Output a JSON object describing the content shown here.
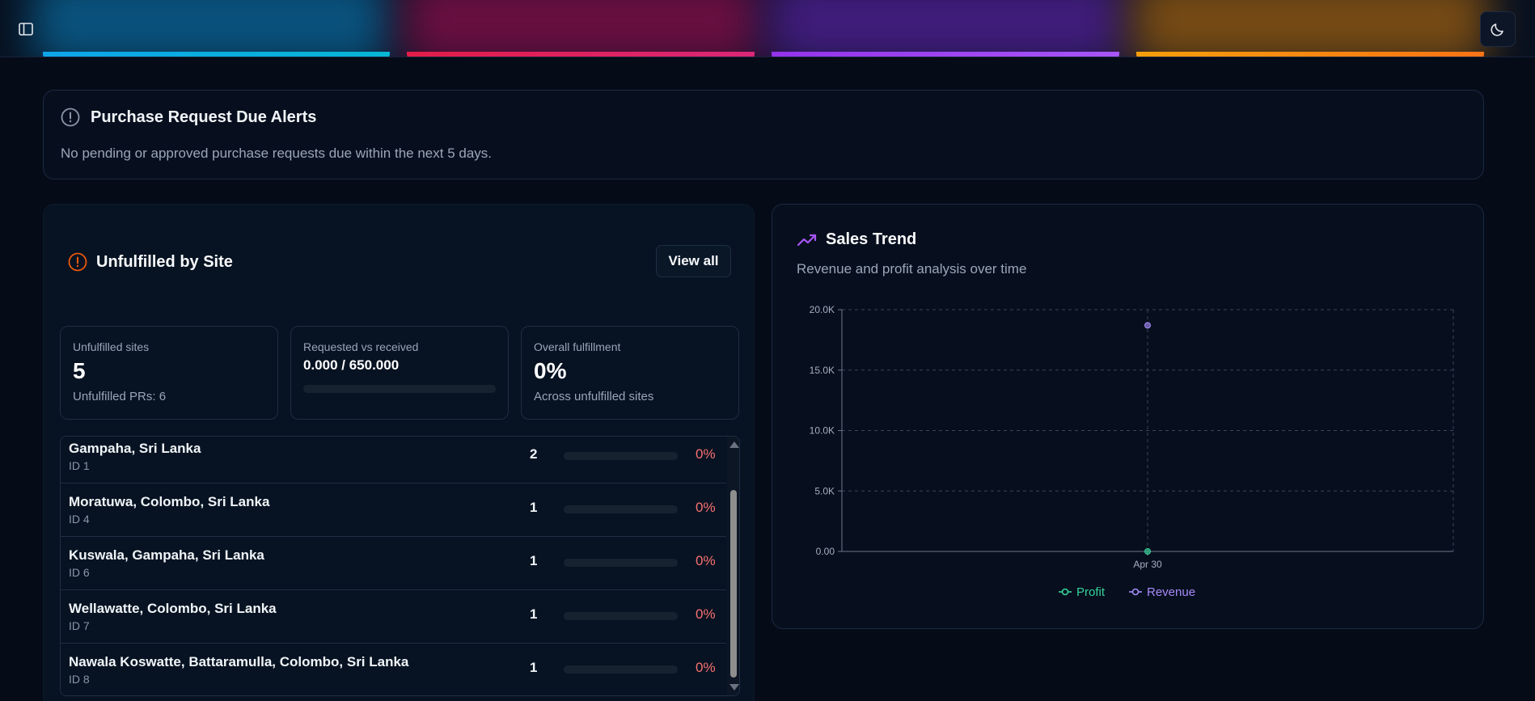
{
  "alerts": {
    "title": "Purchase Request Due Alerts",
    "message": "No pending or approved purchase requests due within the next 5 days."
  },
  "unfulfilled": {
    "title": "Unfulfilled by Site",
    "view_all": "View all",
    "stats": {
      "sites_label": "Unfulfilled sites",
      "sites_value": "5",
      "sites_sub": "Unfulfilled PRs: 6",
      "req_label": "Requested vs received",
      "req_value": "0.000 / 650.000",
      "req_progress": 0,
      "overall_label": "Overall fulfillment",
      "overall_value": "0%",
      "overall_sub": "Across unfulfilled sites"
    },
    "sites": [
      {
        "name": "Gampaha, Sri Lanka",
        "id": "ID 1",
        "count": "2",
        "pct": "0%"
      },
      {
        "name": "Moratuwa, Colombo, Sri Lanka",
        "id": "ID 4",
        "count": "1",
        "pct": "0%"
      },
      {
        "name": "Kuswala, Gampaha, Sri Lanka",
        "id": "ID 6",
        "count": "1",
        "pct": "0%"
      },
      {
        "name": "Wellawatte, Colombo, Sri Lanka",
        "id": "ID 7",
        "count": "1",
        "pct": "0%"
      },
      {
        "name": "Nawala Koswatte, Battaramulla, Colombo, Sri Lanka",
        "id": "ID 8",
        "count": "1",
        "pct": "0%"
      }
    ]
  },
  "sales": {
    "title": "Sales Trend",
    "subtitle": "Revenue and profit analysis over time"
  },
  "chart_data": {
    "type": "line",
    "x": [
      "Apr 30"
    ],
    "y_ticks": [
      "0.00",
      "5.0K",
      "10.0K",
      "15.0K",
      "20.0K"
    ],
    "ylim": [
      0,
      20000
    ],
    "grid": true,
    "legend_position": "bottom",
    "series": [
      {
        "name": "Profit",
        "values": [
          0
        ],
        "color": "#34d399"
      },
      {
        "name": "Revenue",
        "values": [
          18700
        ],
        "color": "#a78bfa"
      }
    ]
  },
  "colors": {
    "accent_red": "#f87171",
    "alert_icon": "#ea580c",
    "trend_icon": "#a855f7"
  }
}
